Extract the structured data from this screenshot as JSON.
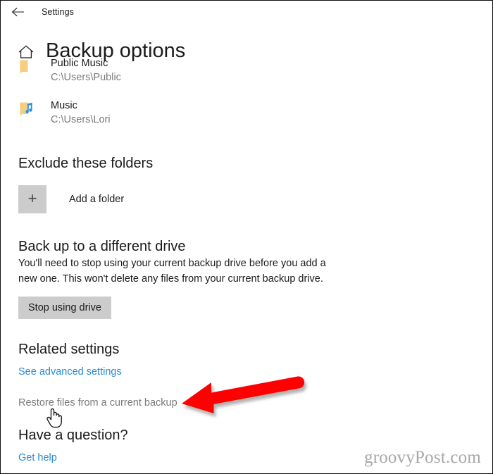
{
  "window": {
    "back_icon": "back-arrow-icon",
    "titlebar_label": "Settings"
  },
  "header": {
    "home_icon": "home-icon",
    "title": "Backup options"
  },
  "backup_folders": [
    {
      "icon": "folder-icon",
      "name": "Public Music",
      "path": "C:\\Users\\Public"
    },
    {
      "icon": "music-folder-icon",
      "name": "Music",
      "path": "C:\\Users\\Lori"
    }
  ],
  "exclude_section": {
    "heading": "Exclude these folders",
    "add_icon": "plus-icon",
    "add_label": "Add a folder"
  },
  "different_drive_section": {
    "heading": "Back up to a different drive",
    "description": "You'll need to stop using your current backup drive before you add a new one. This won't delete any files from your current backup drive.",
    "button_label": "Stop using drive"
  },
  "related_settings": {
    "heading": "Related settings",
    "advanced_link": "See advanced settings",
    "restore_link": "Restore files from a current backup"
  },
  "help_section": {
    "heading": "Have a question?",
    "link": "Get help"
  },
  "annotation": {
    "arrow_icon": "red-arrow-pointing-left",
    "arrow_color": "#FF0000",
    "cursor_icon": "hand-pointer-cursor"
  },
  "watermark": {
    "text": "groovyPost.com"
  },
  "colors": {
    "link_blue": "#2A8AD4",
    "button_gray": "#CCCCCC",
    "folder_tan": "#F6CE7E",
    "music_note_blue": "#2B8FE0",
    "text_primary": "#1B1B1B",
    "text_secondary": "#7A7A7A"
  }
}
